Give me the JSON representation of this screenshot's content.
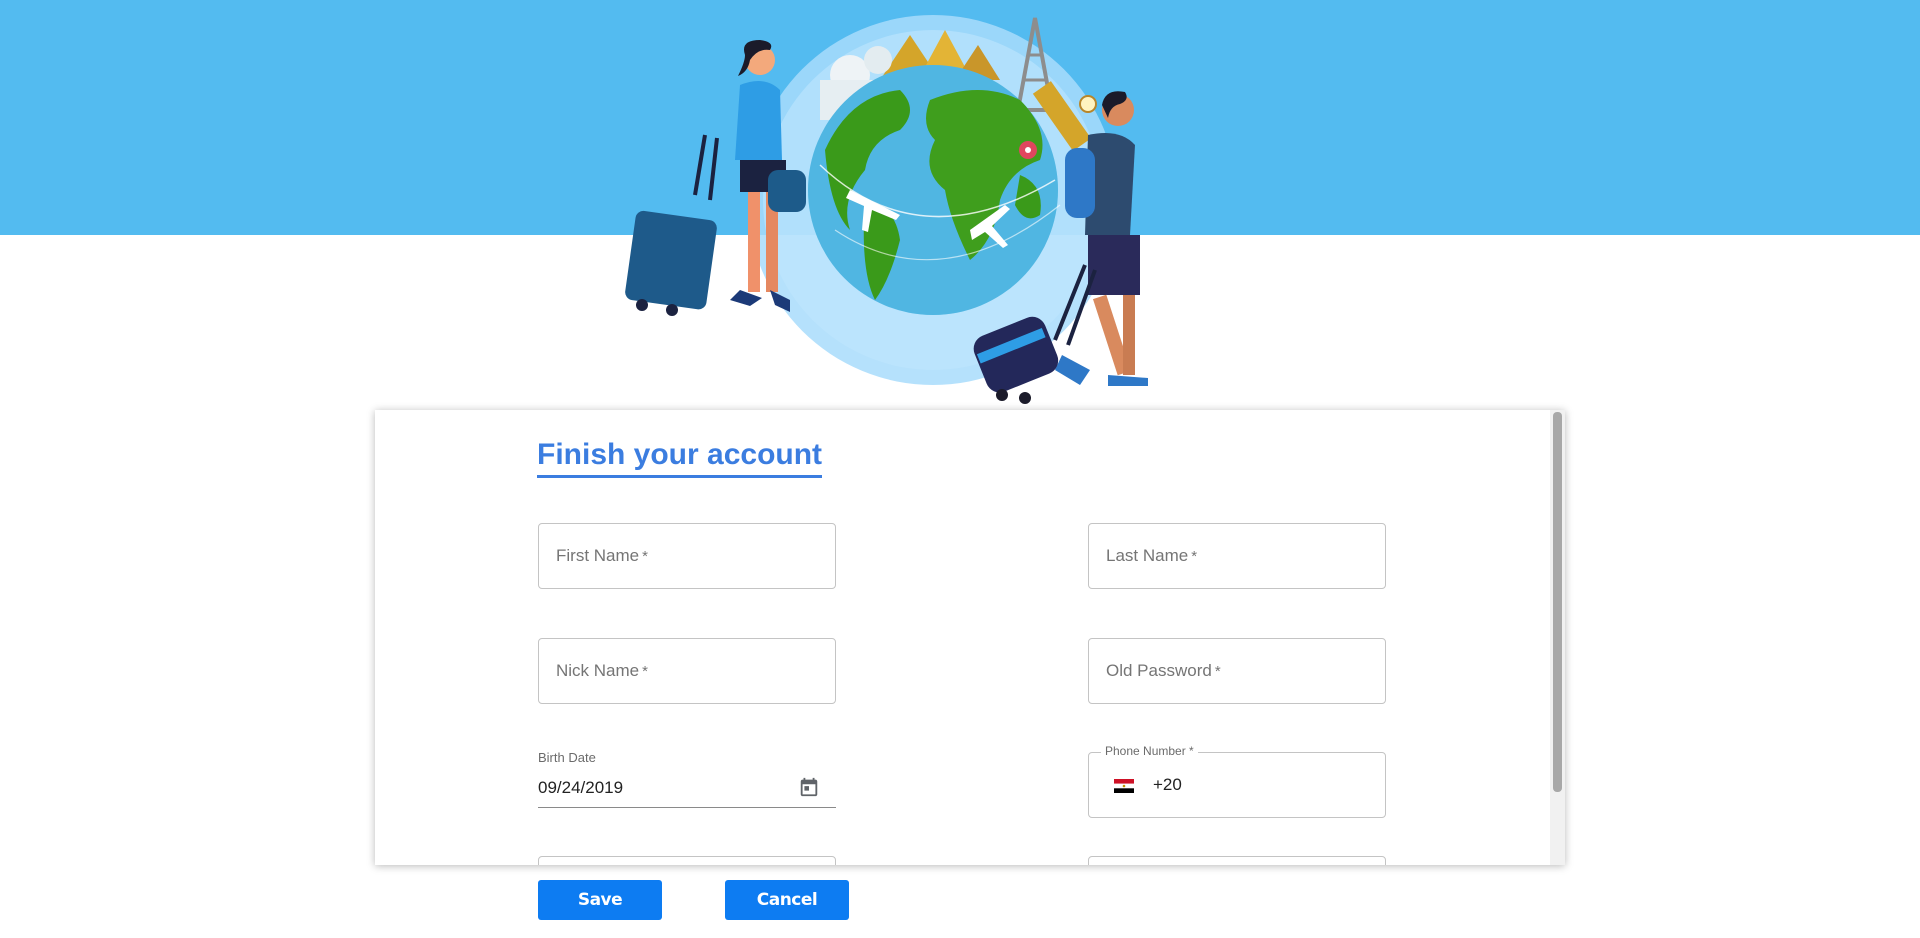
{
  "form": {
    "title": "Finish your account",
    "fields": {
      "first_name": {
        "placeholder": "First Name",
        "required": "*"
      },
      "last_name": {
        "placeholder": "Last Name",
        "required": "*"
      },
      "nick_name": {
        "placeholder": "Nick Name",
        "required": "*"
      },
      "old_password": {
        "placeholder": "Old Password",
        "required": "*"
      },
      "birth_date": {
        "label": "Birth Date",
        "value": "09/24/2019"
      },
      "phone": {
        "label": "Phone Number *",
        "country_code": "+20",
        "country_flag": "egypt-flag-icon"
      }
    }
  },
  "actions": {
    "save_label": "Save",
    "cancel_label": "Cancel"
  },
  "colors": {
    "banner": "#53bbf0",
    "accent": "#3b7de0",
    "button": "#0d7cf2"
  }
}
